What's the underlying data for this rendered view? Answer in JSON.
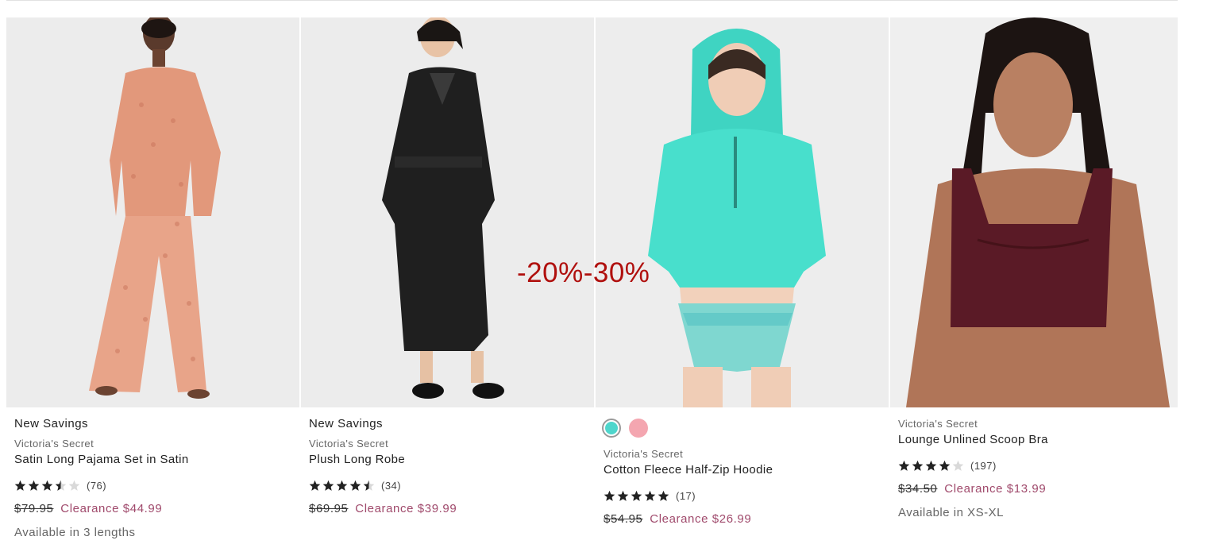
{
  "discount_overlay": "-20%-30%",
  "products": [
    {
      "tag": "New Savings",
      "brand": "Victoria's Secret",
      "name": "Satin Long Pajama Set in Satin",
      "rating": 3.5,
      "review_count": "(76)",
      "old_price": "$79.95",
      "sale_price": "Clearance $44.99",
      "availability": "Available in 3 lengths",
      "image": "pink-leopard-satin-pajama-set",
      "swatches": []
    },
    {
      "tag": "New Savings",
      "brand": "Victoria's Secret",
      "name": "Plush Long Robe",
      "rating": 4.5,
      "review_count": "(34)",
      "old_price": "$69.95",
      "sale_price": "Clearance $39.99",
      "availability": "",
      "image": "black-plush-robe",
      "swatches": []
    },
    {
      "tag": "",
      "brand": "Victoria's Secret",
      "name": "Cotton Fleece Half-Zip Hoodie",
      "rating": 5,
      "review_count": "(17)",
      "old_price": "$54.95",
      "sale_price": "Clearance $26.99",
      "availability": "",
      "image": "aqua-tie-dye-hoodie",
      "swatches": [
        {
          "color": "#4fd6cc",
          "selected": true
        },
        {
          "color": "#f4a6b0",
          "selected": false
        }
      ]
    },
    {
      "tag": "",
      "brand": "Victoria's Secret",
      "name": "Lounge Unlined Scoop Bra",
      "rating": 4,
      "review_count": "(197)",
      "old_price": "$34.50",
      "sale_price": "Clearance $13.99",
      "availability": "Available in XS-XL",
      "image": "burgundy-scoop-bra",
      "swatches": []
    }
  ],
  "colors": {
    "sale": "#a04a6c",
    "discount_overlay": "#b0100e",
    "star": "#222222",
    "star_empty": "#d9d9d9"
  }
}
